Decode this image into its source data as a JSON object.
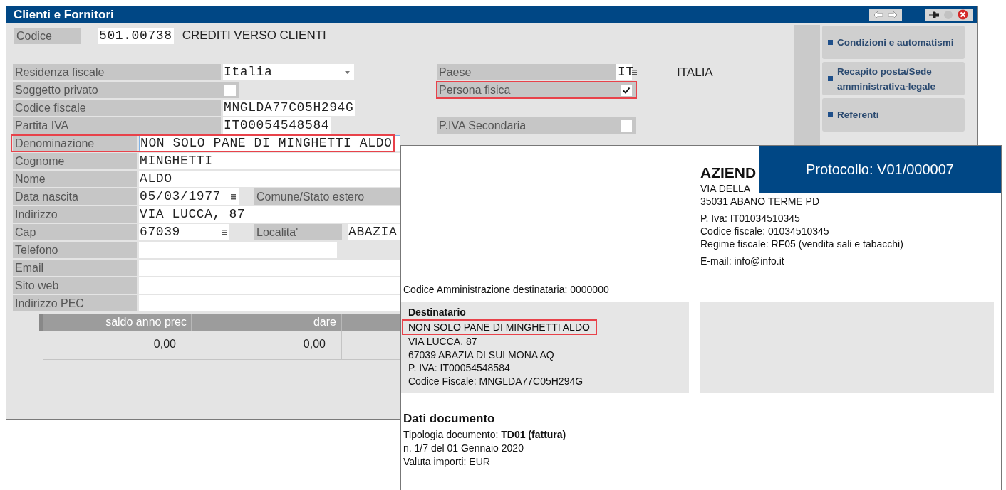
{
  "window": {
    "title": "Clienti e Fornitori"
  },
  "codice": {
    "label": "Codice",
    "value": "501.00738",
    "description": "CREDITI VERSO CLIENTI"
  },
  "fiscal_rows": [
    {
      "label": "Residenza fiscale",
      "kind": "dropdown",
      "value": "Italia",
      "side": {
        "label": "Paese",
        "kind": "lookup",
        "value": "IT",
        "description": "ITALIA",
        "highlighted": false
      }
    },
    {
      "label": "Soggetto privato",
      "kind": "checkbox",
      "checked": false,
      "side": {
        "label": "Persona fisica",
        "kind": "checkbox",
        "checked": true,
        "highlighted": true
      }
    },
    {
      "label": "Codice fiscale",
      "kind": "text",
      "value": "MNGLDA77C05H294G"
    },
    {
      "label": "Partita IVA",
      "kind": "text",
      "value": "IT00054548584",
      "side": {
        "label": "P.IVA Secondaria",
        "kind": "checkbox",
        "checked": false,
        "highlighted": false
      }
    }
  ],
  "anagrafica_rows": [
    {
      "label": "Denominazione",
      "kind": "wide",
      "value": "NON SOLO PANE DI MINGHETTI ALDO",
      "highlighted": true
    },
    {
      "label": "Cognome",
      "kind": "wide",
      "value": "MINGHETTI",
      "highlighted": false
    },
    {
      "label": "Nome",
      "kind": "wide",
      "value": "ALDO",
      "highlighted": false
    },
    {
      "label": "Data nascita",
      "kind": "date",
      "value": "05/03/1977",
      "extra": {
        "label": "Comune/Stato estero"
      },
      "highlighted": false
    },
    {
      "label": "Indirizzo",
      "kind": "wide",
      "value": "VIA LUCCA, 87",
      "highlighted": false
    },
    {
      "label": "Cap",
      "kind": "postcode",
      "value": "67039",
      "extra": {
        "label": "Localita'",
        "value": "ABAZIA"
      },
      "highlighted": false
    },
    {
      "label": "Telefono",
      "kind": "short",
      "highlighted": false
    },
    {
      "label": "Email",
      "kind": "wide",
      "highlighted": false
    },
    {
      "label": "Sito web",
      "kind": "wide",
      "highlighted": false
    },
    {
      "label": "Indirizzo PEC",
      "kind": "wide",
      "highlighted": false
    }
  ],
  "balance_table": {
    "columns": [
      "saldo anno prec",
      "dare"
    ],
    "rows": [
      [
        "0,00",
        "0,00"
      ]
    ]
  },
  "sidebar": {
    "buttons": [
      "Condizioni e automatismi",
      "Recapito posta/Sede amministrativa-legale",
      "Referenti"
    ]
  },
  "document": {
    "protocol": "Protocollo: V01/000007",
    "sender": {
      "name": "AZIEND",
      "address": [
        "VIA DELLA",
        "35031 ABANO TERME PD"
      ],
      "tax": [
        "P. Iva: IT01034510345",
        "Codice fiscale: 01034510345",
        "Regime fiscale: RF05 (vendita sali e tabacchi)"
      ],
      "email": "E-mail: info@info.it"
    },
    "recipient_code": "Codice Amministrazione destinataria: 0000000",
    "recipient": {
      "title": "Destinatario",
      "lines": [
        {
          "text": "NON SOLO PANE DI MINGHETTI ALDO",
          "highlighted": true
        },
        {
          "text": "VIA LUCCA, 87",
          "highlighted": false
        },
        {
          "text": "67039  ABAZIA DI SULMONA  AQ",
          "highlighted": false
        },
        {
          "text": "P. IVA:  IT00054548584",
          "highlighted": false
        },
        {
          "text": "Codice Fiscale:  MNGLDA77C05H294G",
          "highlighted": false
        }
      ]
    },
    "details": {
      "title": "Dati documento",
      "lines": [
        "Tipologia documento: **TD01 (fattura)**",
        "n. 1/7 del 01 Gennaio 2020",
        "Valuta importi: EUR"
      ]
    }
  }
}
